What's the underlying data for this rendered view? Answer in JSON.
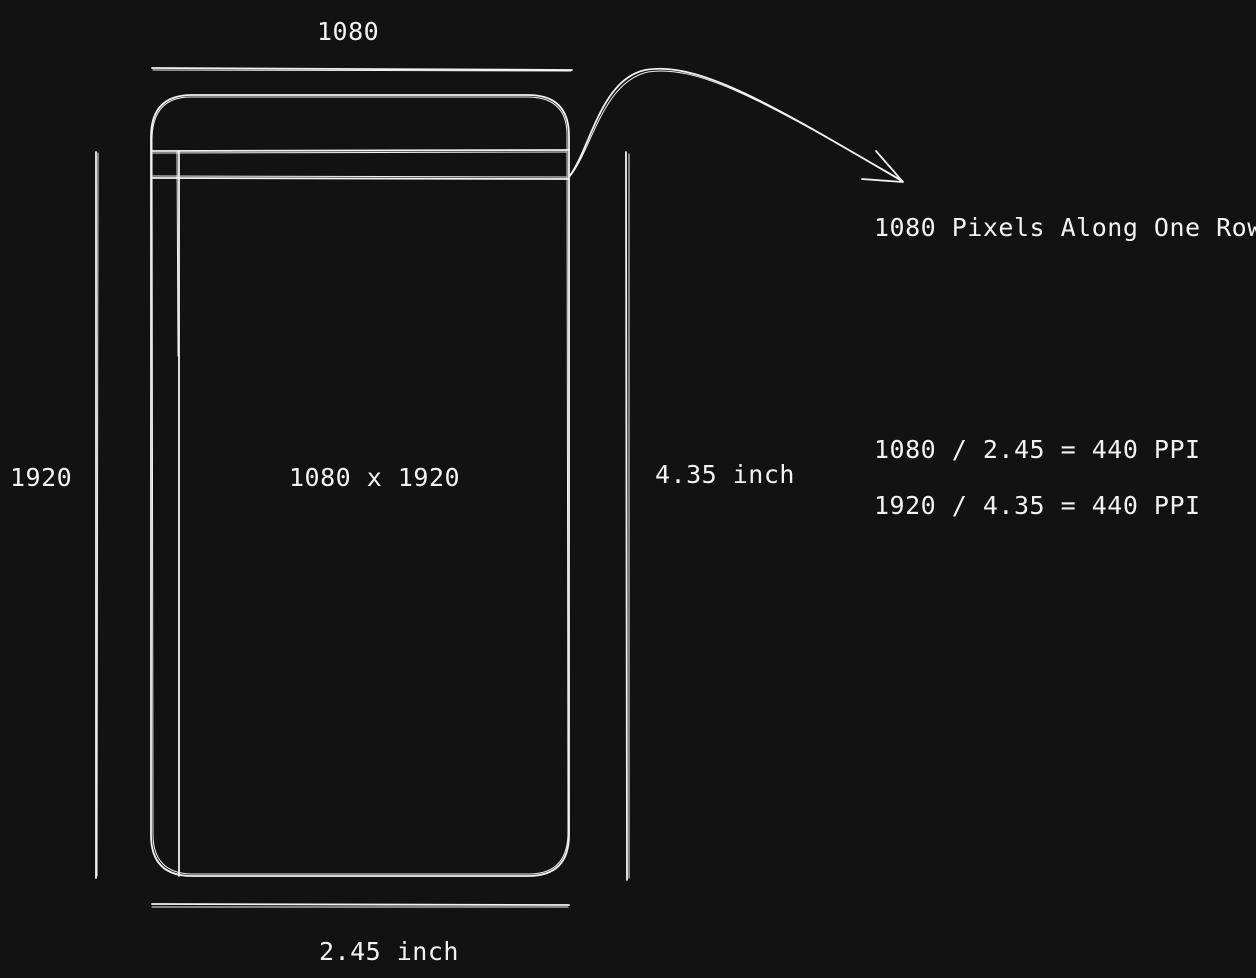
{
  "diagram": {
    "stroke_color": "#f2f2f2",
    "background_color": "#121212",
    "labels": {
      "top_width_px": "1080",
      "left_height_px": "1920",
      "center_resolution": "1080 x 1920",
      "right_height_in": "4.35 inch",
      "bottom_width_in": "2.45 inch",
      "pixels_row_note": "1080 Pixels Along One Row",
      "calc_width": "1080 / 2.45 = 440 PPI",
      "calc_height": "1920 / 4.35 = 440 PPI"
    }
  }
}
